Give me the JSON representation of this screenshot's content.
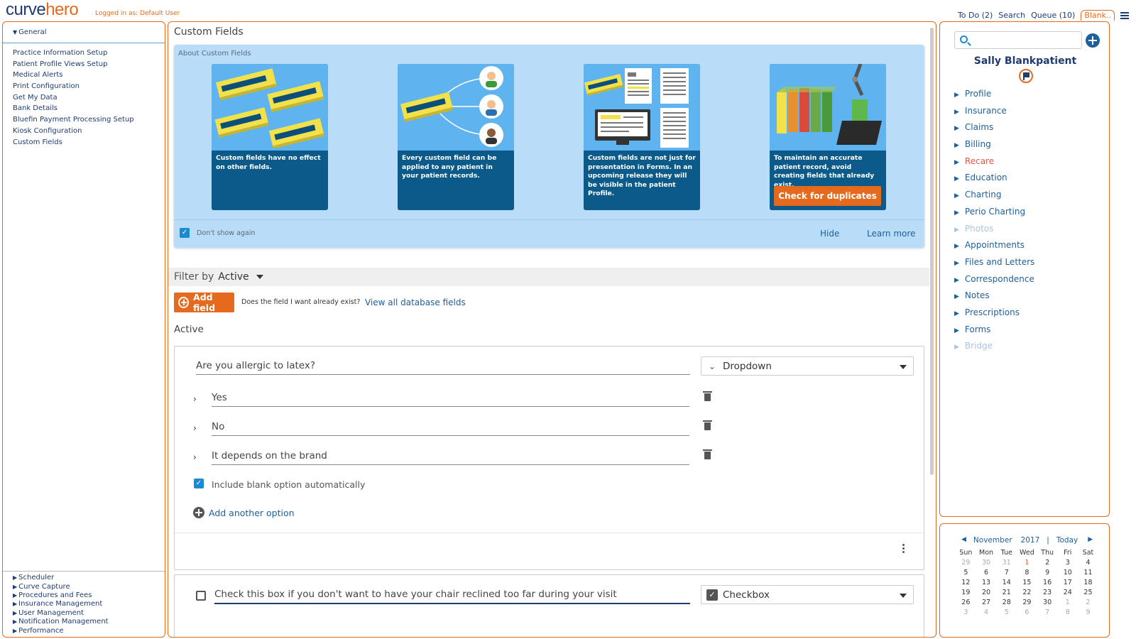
{
  "app": {
    "logo_part1": "curve",
    "logo_part2": "hero",
    "logged_in": "Logged in as: Default User"
  },
  "topnav": {
    "todo": "To Do (2)",
    "search": "Search",
    "queue": "Queue (10)",
    "tab": "Blank.."
  },
  "sidebar": {
    "header": "General",
    "items": [
      {
        "label": "Practice Information Setup"
      },
      {
        "label": "Patient Profile Views Setup"
      },
      {
        "label": "Medical Alerts"
      },
      {
        "label": "Print Configuration"
      },
      {
        "label": "Get My Data"
      },
      {
        "label": "Bank Details"
      },
      {
        "label": "Bluefin Payment Processing Setup"
      },
      {
        "label": "Kiosk Configuration"
      },
      {
        "label": "Custom Fields"
      }
    ],
    "bottom_items": [
      {
        "label": "Scheduler"
      },
      {
        "label": "Curve Capture"
      },
      {
        "label": "Procedures and Fees"
      },
      {
        "label": "Insurance Management"
      },
      {
        "label": "User Management"
      },
      {
        "label": "Notification Management"
      },
      {
        "label": "Performance"
      }
    ]
  },
  "main": {
    "title": "Custom Fields",
    "about": {
      "label": "About Custom Fields",
      "cards": [
        {
          "text": "Custom fields have no effect on other fields."
        },
        {
          "text": "Every custom field can be applied to any patient in your patient records."
        },
        {
          "text": "Custom fields are not just for presentation in Forms. In an upcoming release they will be visible in the patient Profile."
        },
        {
          "text": "To maintain an accurate patient record, avoid creating fields that already exist.",
          "button": "Check for duplicates"
        }
      ],
      "dont_show": "Don't show again",
      "hide": "Hide",
      "learn_more": "Learn more"
    },
    "filter": {
      "label": "Filter by",
      "value": "Active"
    },
    "add_field": "Add field",
    "question": "Does the field I want already exist?",
    "view_all": "View all database fields",
    "active_header": "Active",
    "field1": {
      "question": "Are you allergic to latex?",
      "type": "Dropdown",
      "options": [
        "Yes",
        "No",
        "It depends on the brand"
      ],
      "include_blank": "Include blank option automatically",
      "add_option": "Add another option"
    },
    "field2": {
      "question": "Check this box if you don't want to have your chair reclined too far during your visit",
      "type": "Checkbox"
    }
  },
  "patient": {
    "name": "Sally Blankpatient",
    "nav": [
      {
        "label": "Profile",
        "state": "normal"
      },
      {
        "label": "Insurance",
        "state": "normal"
      },
      {
        "label": "Claims",
        "state": "normal"
      },
      {
        "label": "Billing",
        "state": "normal"
      },
      {
        "label": "Recare",
        "state": "alert"
      },
      {
        "label": "Education",
        "state": "normal"
      },
      {
        "label": "Charting",
        "state": "normal"
      },
      {
        "label": "Perio Charting",
        "state": "normal"
      },
      {
        "label": "Photos",
        "state": "disabled"
      },
      {
        "label": "Appointments",
        "state": "normal"
      },
      {
        "label": "Files and Letters",
        "state": "normal"
      },
      {
        "label": "Correspondence",
        "state": "normal"
      },
      {
        "label": "Notes",
        "state": "normal"
      },
      {
        "label": "Prescriptions",
        "state": "normal"
      },
      {
        "label": "Forms",
        "state": "normal"
      },
      {
        "label": "Bridge",
        "state": "disabled"
      }
    ]
  },
  "calendar": {
    "month": "November",
    "year": "2017",
    "sep": "|",
    "today": "Today",
    "dow": [
      "Sun",
      "Mon",
      "Tue",
      "Wed",
      "Thu",
      "Fri",
      "Sat"
    ],
    "weeks": [
      [
        "29",
        "30",
        "31",
        "1",
        "2",
        "3",
        "4"
      ],
      [
        "5",
        "6",
        "7",
        "8",
        "9",
        "10",
        "11"
      ],
      [
        "12",
        "13",
        "14",
        "15",
        "16",
        "17",
        "18"
      ],
      [
        "19",
        "20",
        "21",
        "22",
        "23",
        "24",
        "25"
      ],
      [
        "26",
        "27",
        "28",
        "29",
        "30",
        "1",
        "2"
      ],
      [
        "3",
        "4",
        "5",
        "6",
        "7",
        "8",
        "9"
      ]
    ]
  },
  "colors": {
    "brand_navy": "#1f3b73",
    "accent_orange": "#e66a1e",
    "link_blue": "#1f5f9a",
    "about_bg": "#b9dcf8",
    "card_bg": "#0b5a8a",
    "alert_red": "#e05a47"
  }
}
